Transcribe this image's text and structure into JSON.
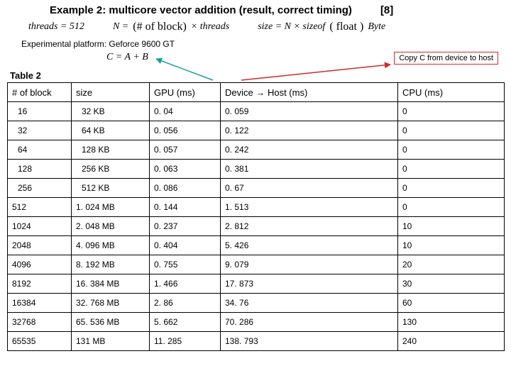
{
  "title": "Example 2: multicore vector addition (result, correct timing)",
  "page_ref": "[8]",
  "formulas": {
    "threads": "threads = 512",
    "N_lhs": "N =",
    "N_rhs_paren": "(# of block)",
    "N_rhs_times": "× threads",
    "size_lhs": "size = N × sizeof",
    "size_paren": "( float )",
    "size_unit": "Byte",
    "cab": "C = A + B"
  },
  "platform": "Experimental platform: Geforce 9600 GT",
  "callout": "Copy C from device to host",
  "table_label": "Table 2",
  "headers": {
    "block": "# of block",
    "size": "size",
    "gpu": "GPU (ms)",
    "dev_host": "Device → Host  (ms)",
    "cpu": "CPU (ms)"
  },
  "chart_data": {
    "type": "table",
    "columns": [
      "# of block",
      "size",
      "GPU (ms)",
      "Device → Host (ms)",
      "CPU (ms)"
    ],
    "rows": [
      {
        "block": "16",
        "size": "32 KB",
        "gpu": "0. 04",
        "dev": "0. 059",
        "cpu": "0"
      },
      {
        "block": "32",
        "size": "64 KB",
        "gpu": "0. 056",
        "dev": "0. 122",
        "cpu": "0"
      },
      {
        "block": "64",
        "size": "128 KB",
        "gpu": "0. 057",
        "dev": "0. 242",
        "cpu": "0"
      },
      {
        "block": "128",
        "size": "256 KB",
        "gpu": "0. 063",
        "dev": "0. 381",
        "cpu": "0"
      },
      {
        "block": "256",
        "size": "512 KB",
        "gpu": "0. 086",
        "dev": "0. 67",
        "cpu": "0"
      },
      {
        "block": "512",
        "size": "1. 024 MB",
        "gpu": "0. 144",
        "dev": "1. 513",
        "cpu": "0"
      },
      {
        "block": "1024",
        "size": "2. 048 MB",
        "gpu": "0. 237",
        "dev": "2. 812",
        "cpu": "10"
      },
      {
        "block": "2048",
        "size": "4. 096 MB",
        "gpu": "0. 404",
        "dev": "5. 426",
        "cpu": "10"
      },
      {
        "block": "4096",
        "size": "8. 192 MB",
        "gpu": "0. 755",
        "dev": "9. 079",
        "cpu": "20"
      },
      {
        "block": "8192",
        "size": "16. 384 MB",
        "gpu": "1. 466",
        "dev": "17. 873",
        "cpu": "30"
      },
      {
        "block": "16384",
        "size": "32. 768 MB",
        "gpu": "2. 86",
        "dev": "34. 76",
        "cpu": "60"
      },
      {
        "block": "32768",
        "size": "65. 536 MB",
        "gpu": "5. 662",
        "dev": "70. 286",
        "cpu": "130"
      },
      {
        "block": "65535",
        "size": "131   MB",
        "gpu": "11. 285",
        "dev": "138. 793",
        "cpu": "240"
      }
    ]
  }
}
